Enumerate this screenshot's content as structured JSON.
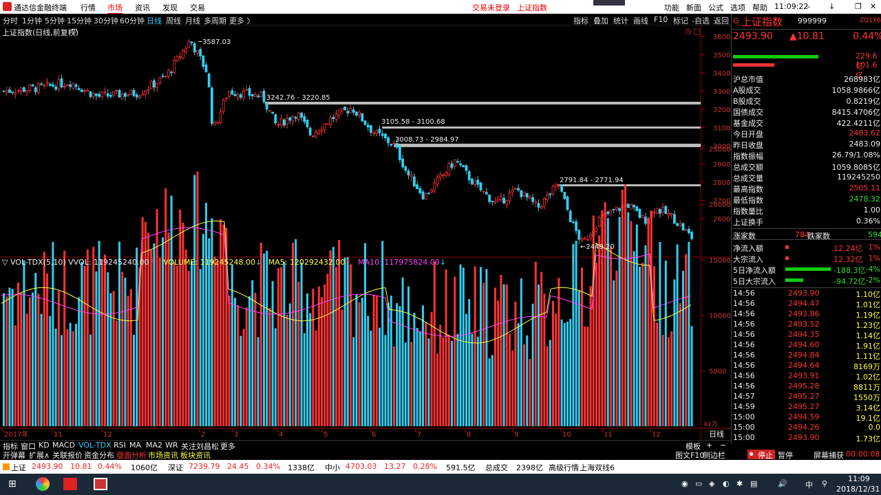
{
  "app": {
    "title": "通达信金融终端",
    "menus": [
      "行情",
      "市场",
      "资讯",
      "发现",
      "交易"
    ],
    "notice1": "交易未登录",
    "notice2": "上证指数",
    "right_menus": [
      "功能",
      "新面",
      "公式",
      "选项",
      "帮助"
    ],
    "clock": "11:09:22"
  },
  "toolbar": {
    "periods": [
      "分时",
      "1分钟",
      "5分钟",
      "15分钟",
      "30分钟",
      "60分钟",
      "日线",
      "周线",
      "月线",
      "多周期",
      "更多 〉"
    ],
    "right": [
      "指标",
      "叠加",
      "统计",
      "画线",
      "F10",
      "标记",
      "-自选",
      "返回"
    ]
  },
  "chart": {
    "title": "上证指数(日线,前复权)",
    "y_ticks": [
      "3600",
      "3500",
      "3400",
      "3300",
      "3200",
      "3100",
      "3000",
      "2900",
      "2800",
      "2700",
      "2600"
    ],
    "high_label": "3587.03",
    "low_label": "2449.20",
    "gaps": [
      "3242.76 - 3220.85",
      "3105.58 - 3100.68",
      "3008.73 - 2984.97",
      "2791.84 - 2771.94"
    ]
  },
  "volume": {
    "header_name": "VOL-TDX(5,10)",
    "vvol": "VVOL: 119245240.00",
    "volume": "VOLUME: 119245248.00",
    "ma5": "MA5: 120292432.00",
    "ma10": "MA10: 117975824.00",
    "y_ticks": [
      "25000",
      "20000",
      "15000",
      "10000",
      "5000"
    ],
    "unit": "X1万"
  },
  "x_axis": {
    "labels": [
      "2017年",
      "11",
      "12",
      "2",
      "3",
      "4",
      "5",
      "6",
      "7",
      "8",
      "9",
      "10",
      "11",
      "12"
    ],
    "period_label": "日线"
  },
  "side": {
    "name": "上证指数",
    "code": "999999",
    "tag": "G",
    "price": "2493.90",
    "change": "▲10.81",
    "pct": "0.44%",
    "bar1": "229.6亿",
    "bar2": "101.6亿",
    "stats": [
      [
        "沪总市值",
        "268983亿"
      ],
      [
        "A股成交",
        "1058.9866亿"
      ],
      [
        "B股成交",
        "0.8219亿"
      ],
      [
        "国债成交",
        "8415.4706亿"
      ],
      [
        "基金成交",
        "422.4211亿"
      ],
      [
        "今日开盘",
        "2483.62"
      ],
      [
        "昨日收盘",
        "2483.09"
      ],
      [
        "指数振幅",
        "26.79/1.08%"
      ],
      [
        "总成交额",
        "1059.8085亿"
      ],
      [
        "总成交量",
        "119245250"
      ],
      [
        "最高指数",
        "2505.11"
      ],
      [
        "最低指数",
        "2478.32"
      ],
      [
        "指数量比",
        "1.00"
      ],
      [
        "上证换手",
        "0.36%"
      ]
    ],
    "updown": {
      "up_label": "涨家数",
      "up": "784",
      "down_label": "跌家数",
      "down": "594"
    },
    "flows": [
      [
        "净流入额",
        "12.24亿",
        "1%"
      ],
      [
        "大宗流入",
        "12.32亿",
        "1%"
      ],
      [
        "5日净流入额",
        "-188.3亿",
        "-4%"
      ],
      [
        "5日大宗流入",
        "-94.72亿",
        "-2%"
      ]
    ],
    "ticks": [
      [
        "14:56",
        "2493.90",
        "1.10亿"
      ],
      [
        "14:56",
        "2494.47",
        "1.01亿"
      ],
      [
        "14:56",
        "2493.86",
        "1.19亿"
      ],
      [
        "14:56",
        "2493.52",
        "1.23亿"
      ],
      [
        "14:56",
        "2494.35",
        "1.14亿"
      ],
      [
        "14:56",
        "2494.60",
        "1.91亿"
      ],
      [
        "14:56",
        "2494.84",
        "1.11亿"
      ],
      [
        "14:56",
        "2494.64",
        "8169万"
      ],
      [
        "14:56",
        "2493.91",
        "1.02亿"
      ],
      [
        "14:56",
        "2495.28",
        "8811万"
      ],
      [
        "14:57",
        "2495.27",
        "1550万"
      ],
      [
        "14:59",
        "2495.27",
        "3.14亿"
      ],
      [
        "15:00",
        "2494.59",
        "19.1亿"
      ],
      [
        "15:00",
        "2494.26",
        "0.0"
      ],
      [
        "15:00",
        "2493.90",
        "1.73亿"
      ]
    ]
  },
  "bottom_tabs": [
    "指标",
    "窗口",
    "KD",
    "MACD",
    "VOL-TDX",
    "RSI",
    "MA",
    "MA2",
    "WR",
    "关注刘昌松",
    "更多"
  ],
  "bottom_tabs2": [
    "开弹幕",
    "扩展∧",
    "关联报价",
    "资金分布",
    "盘面分析",
    "市场资讯",
    "板块资讯"
  ],
  "bottom_right": [
    "模板",
    "图文F10",
    "侧边栏"
  ],
  "bottom_buttons": [
    "停止",
    "暂停",
    "屏幕捕获",
    "00:00:08"
  ],
  "statusbar": [
    [
      "上证",
      "2493.90",
      "10.81",
      "0.44%",
      "1060亿"
    ],
    [
      "深证",
      "7239.79",
      "24.45",
      "0.34%",
      "1338亿"
    ],
    [
      "中小",
      "4703.03",
      "13.27",
      "0.28%",
      "591.5亿"
    ]
  ],
  "status_extra": [
    "总成交",
    "2398亿",
    "高级行情",
    "上海双线6"
  ],
  "taskbar": {
    "time": "11:09",
    "date": "2018/12/31",
    "ime": "中"
  },
  "colors": {
    "up": "#ff3333",
    "down": "#33ccee",
    "ma5": "#ffff44",
    "ma10": "#ff44ff"
  }
}
